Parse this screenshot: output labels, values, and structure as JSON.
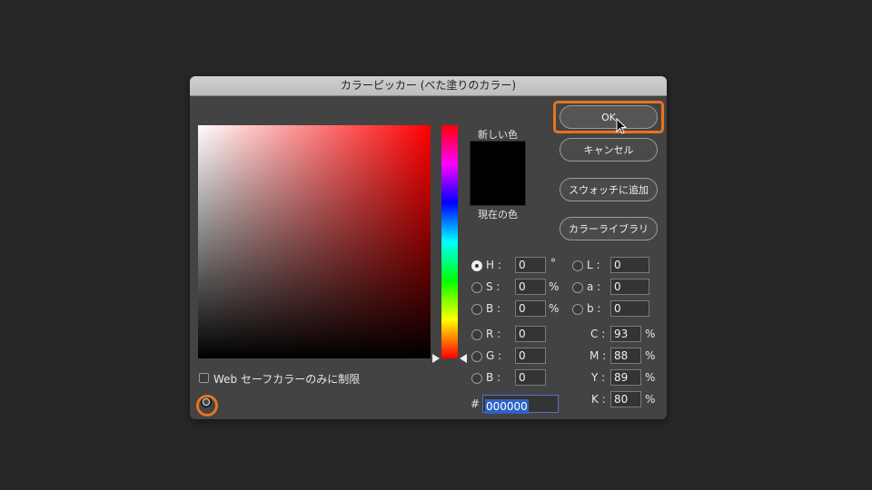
{
  "dialog": {
    "title": "カラーピッカー (べた塗りのカラー)",
    "new_color_label": "新しい色",
    "current_color_label": "現在の色",
    "new_color": "#000000",
    "current_color": "#000000",
    "web_safe_label": "Web セーフカラーのみに制限"
  },
  "buttons": {
    "ok": "OK",
    "cancel": "キャンセル",
    "add_swatch": "スウォッチに追加",
    "color_libraries": "カラーライブラリ"
  },
  "fields": {
    "h": {
      "label": "H :",
      "value": "0",
      "unit": "°"
    },
    "s": {
      "label": "S :",
      "value": "0",
      "unit": "%"
    },
    "b": {
      "label": "B :",
      "value": "0",
      "unit": "%"
    },
    "r": {
      "label": "R :",
      "value": "0"
    },
    "g": {
      "label": "G :",
      "value": "0"
    },
    "bb": {
      "label": "B :",
      "value": "0"
    },
    "l": {
      "label": "L :",
      "value": "0"
    },
    "a": {
      "label": "a :",
      "value": "0"
    },
    "lab_b": {
      "label": "b :",
      "value": "0"
    },
    "c": {
      "label": "C :",
      "value": "93",
      "unit": "%"
    },
    "m": {
      "label": "M :",
      "value": "88",
      "unit": "%"
    },
    "y": {
      "label": "Y :",
      "value": "89",
      "unit": "%"
    },
    "k": {
      "label": "K :",
      "value": "80",
      "unit": "%"
    },
    "hex_prefix": "#",
    "hex": "000000"
  },
  "colors": {
    "highlight": "#e8731f",
    "hue_base": "#ff0000"
  }
}
